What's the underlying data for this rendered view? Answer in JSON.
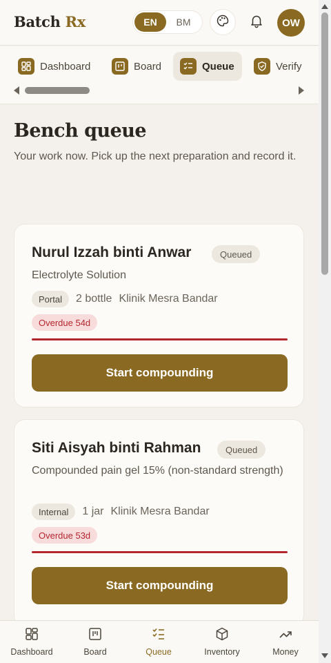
{
  "brand": {
    "name": "Batch ",
    "accent": "Rx"
  },
  "language": {
    "options": [
      "EN",
      "BM"
    ],
    "selected": "EN"
  },
  "header": {
    "avatar_initials": "OW",
    "theme_icon": "palette-icon",
    "notifications_icon": "bell-icon"
  },
  "tabs": [
    {
      "label": "Dashboard",
      "icon": "dashboard-icon",
      "active": false
    },
    {
      "label": "Board",
      "icon": "board-icon",
      "active": false
    },
    {
      "label": "Queue",
      "icon": "queue-icon",
      "active": true
    },
    {
      "label": "Verify",
      "icon": "shield-icon",
      "active": false
    }
  ],
  "page": {
    "title": "Bench queue",
    "subtitle": "Your work now. Pick up the next preparation and record it."
  },
  "cards": [
    {
      "patient": "Nurul Izzah binti Anwar",
      "status": "Queued",
      "product": "Electrolyte Solution",
      "source": "Portal",
      "quantity": "2 bottle",
      "clinic": "Klinik Mesra Bandar",
      "overdue": "Overdue 54d",
      "action": "Start compounding"
    },
    {
      "patient": "Siti Aisyah binti Rahman",
      "status": "Queued",
      "product": "Compounded pain gel 15% (non-standard strength)",
      "source": "Internal",
      "quantity": "1 jar",
      "clinic": "Klinik Mesra Bandar",
      "overdue": "Overdue 53d",
      "action": "Start compounding"
    }
  ],
  "bottom_nav": [
    {
      "label": "Dashboard",
      "icon": "dashboard-icon",
      "active": false
    },
    {
      "label": "Board",
      "icon": "board-icon",
      "active": false
    },
    {
      "label": "Queue",
      "icon": "queue-icon",
      "active": true
    },
    {
      "label": "Inventory",
      "icon": "box-icon",
      "active": false
    },
    {
      "label": "Money",
      "icon": "trend-icon",
      "active": false
    }
  ],
  "colors": {
    "accent": "#8a6a22",
    "overdue": "#b3262e",
    "background": "#f4f1ec"
  }
}
